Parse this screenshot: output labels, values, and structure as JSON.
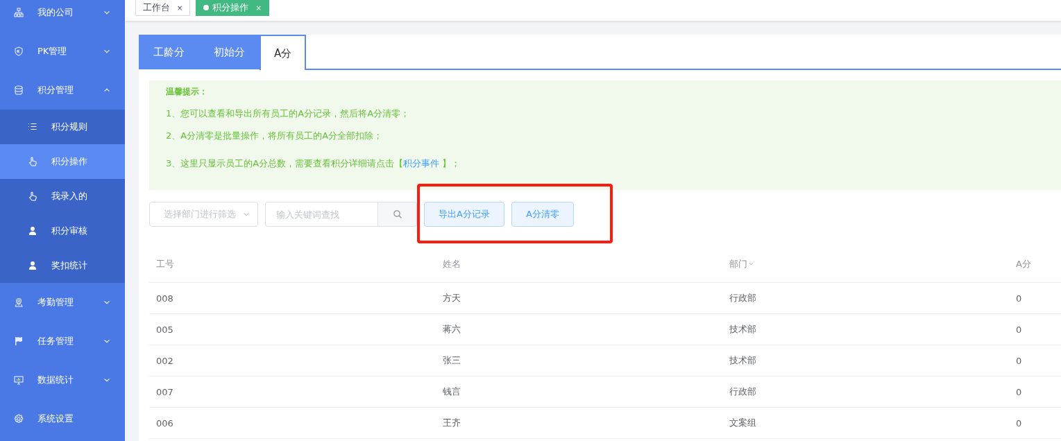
{
  "sidebar": {
    "items": [
      {
        "kind": "group",
        "label": "我的公司",
        "expanded": false
      },
      {
        "kind": "group",
        "label": "PK管理",
        "expanded": false
      },
      {
        "kind": "group",
        "label": "积分管理",
        "expanded": true,
        "children": [
          {
            "label": "积分规则",
            "selected": false
          },
          {
            "label": "积分操作",
            "selected": true
          },
          {
            "label": "我录入的",
            "selected": false
          },
          {
            "label": "积分审核",
            "selected": false
          },
          {
            "label": "奖扣统计",
            "selected": false
          }
        ]
      },
      {
        "kind": "group",
        "label": "考勤管理",
        "expanded": false
      },
      {
        "kind": "group",
        "label": "任务管理",
        "expanded": false
      },
      {
        "kind": "group",
        "label": "数据统计",
        "expanded": false
      },
      {
        "kind": "link",
        "label": "系统设置"
      }
    ]
  },
  "page_tabs": [
    {
      "label": "工作台",
      "close": "×",
      "selected": false
    },
    {
      "label": "积分操作",
      "close": "×",
      "selected": true
    }
  ],
  "tabs": [
    {
      "label": "工龄分",
      "selected": false
    },
    {
      "label": "初始分",
      "selected": false
    },
    {
      "label": "A分",
      "selected": true
    }
  ],
  "tip": {
    "title": "温馨提示：",
    "lines": [
      {
        "text": "1、您可以查看和导出所有员工的A分记录，然后将A分清零；"
      },
      {
        "text": "2、A分清零是批量操作，将所有员工的A分全部扣除；"
      },
      {
        "text": "3、这里只显示员工的A分总数，需要查看积分详细请点击",
        "open": "【",
        "link": "积分事件",
        "close": " 】",
        "end": "；"
      }
    ]
  },
  "filters": {
    "department": {
      "placeholder": "选择部门进行筛选"
    },
    "search": {
      "placeholder": "输入关键词查找"
    }
  },
  "buttons": [
    "导出A分记录",
    "A分清零"
  ],
  "table": {
    "columns": [
      {
        "label": "工号",
        "filter": false
      },
      {
        "label": "姓名",
        "filter": false
      },
      {
        "label": "部门",
        "filter": true
      },
      {
        "label": "A分",
        "filter": false
      }
    ],
    "rows": [
      [
        "008",
        "方天",
        "行政部",
        "0"
      ],
      [
        "005",
        "蒋六",
        "技术部",
        "0"
      ],
      [
        "002",
        "张三",
        "技术部",
        "0"
      ],
      [
        "007",
        "钱言",
        "行政部",
        "0"
      ],
      [
        "006",
        "王齐",
        "文案组",
        "0"
      ]
    ]
  }
}
